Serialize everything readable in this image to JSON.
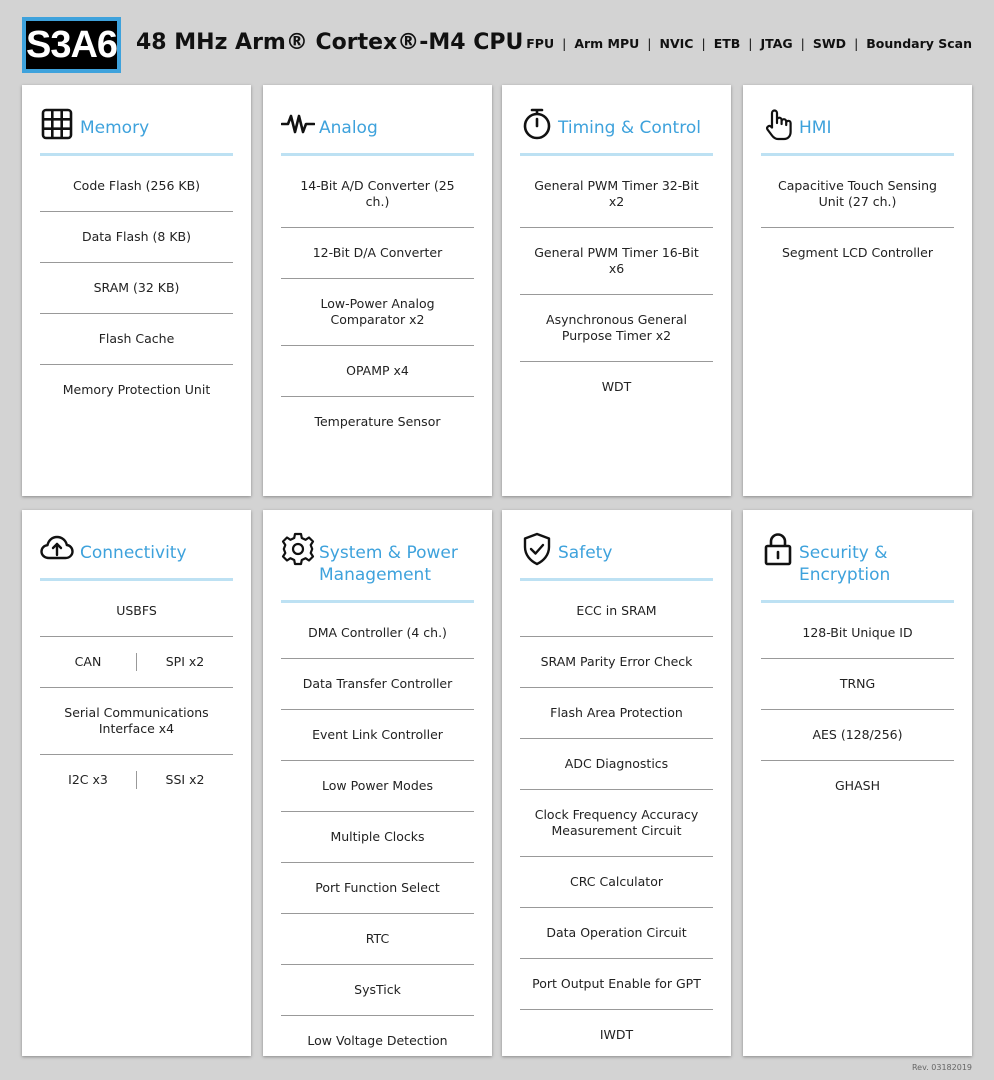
{
  "header": {
    "logo": "S3A6",
    "title": "48 MHz Arm® Cortex®-M4 CPU",
    "features": [
      "FPU",
      "Arm MPU",
      "NVIC",
      "ETB",
      "JTAG",
      "SWD",
      "Boundary Scan"
    ]
  },
  "colors": {
    "accent": "#3ea2dc",
    "accent_light": "#bde1f3",
    "background": "#d3d3d3"
  },
  "cards": {
    "memory": {
      "title": "Memory",
      "icon": "grid-icon",
      "items": [
        "Code Flash (256 KB)",
        "Data Flash (8 KB)",
        "SRAM (32 KB)",
        "Flash Cache",
        "Memory Protection Unit"
      ]
    },
    "analog": {
      "title": "Analog",
      "icon": "waveform-icon",
      "items": [
        "14-Bit A/D Converter (25 ch.)",
        "12-Bit D/A Converter",
        "Low-Power Analog Comparator x2",
        "OPAMP x4",
        "Temperature Sensor"
      ]
    },
    "timing": {
      "title": "Timing & Control",
      "icon": "stopwatch-icon",
      "items": [
        "General PWM Timer 32-Bit x2",
        "General PWM Timer 16-Bit x6",
        "Asynchronous General Purpose Timer x2",
        "WDT"
      ]
    },
    "hmi": {
      "title": "HMI",
      "icon": "touch-hand-icon",
      "items": [
        "Capacitive Touch Sensing Unit (27 ch.)",
        "Segment LCD Controller"
      ]
    },
    "connectivity": {
      "title": "Connectivity",
      "icon": "cloud-upload-icon",
      "items": {
        "usbfs": "USBFS",
        "can": "CAN",
        "spi": "SPI x2",
        "sci": "Serial Communications Interface x4",
        "i2c": "I2C x3",
        "ssi": "SSI x2"
      }
    },
    "system": {
      "title": "System & Power Management",
      "icon": "gear-icon",
      "items": [
        "DMA Controller (4 ch.)",
        "Data Transfer Controller",
        "Event Link Controller",
        "Low Power Modes",
        "Multiple Clocks",
        "Port Function Select",
        "RTC",
        "SysTick",
        "Low Voltage Detection"
      ]
    },
    "safety": {
      "title": "Safety",
      "icon": "shield-check-icon",
      "items": [
        "ECC in SRAM",
        "SRAM Parity Error Check",
        "Flash Area Protection",
        "ADC Diagnostics",
        "Clock Frequency Accuracy Measurement Circuit",
        "CRC Calculator",
        "Data Operation Circuit",
        "Port Output Enable for GPT",
        "IWDT"
      ]
    },
    "security": {
      "title": "Security & Encryption",
      "icon": "padlock-icon",
      "items": [
        "128-Bit Unique ID",
        "TRNG",
        "AES (128/256)",
        "GHASH"
      ]
    }
  },
  "footer": {
    "revision": "Rev. 03182019"
  }
}
